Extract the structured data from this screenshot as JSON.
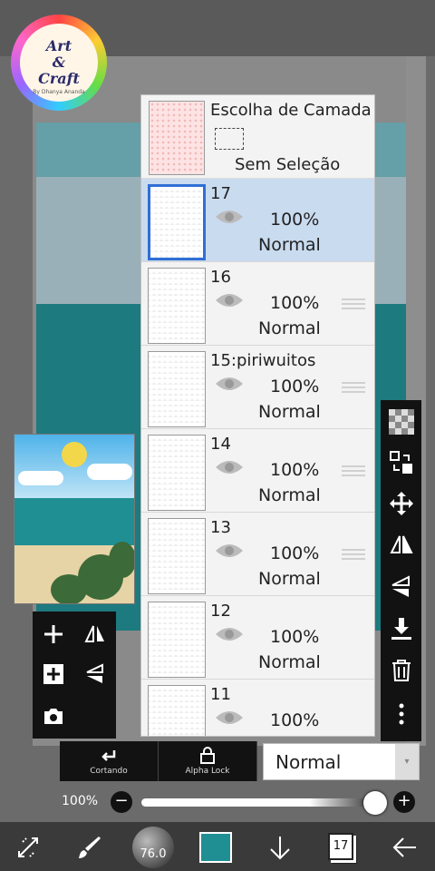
{
  "logo": {
    "line1": "Art",
    "line2": "&",
    "line3": "Craft",
    "subtitle": "By Dhanya Ananda"
  },
  "selection_layer": {
    "title": "Escolha de Camada",
    "status": "Sem Seleção"
  },
  "layers": [
    {
      "name": "17",
      "opacity": "100%",
      "blend": "Normal",
      "selected": true
    },
    {
      "name": "16",
      "opacity": "100%",
      "blend": "Normal",
      "selected": false
    },
    {
      "name": "15:piriwuitos",
      "opacity": "100%",
      "blend": "Normal",
      "selected": false
    },
    {
      "name": "14",
      "opacity": "100%",
      "blend": "Normal",
      "selected": false
    },
    {
      "name": "13",
      "opacity": "100%",
      "blend": "Normal",
      "selected": false
    },
    {
      "name": "12",
      "opacity": "100%",
      "blend": "Normal",
      "selected": false
    },
    {
      "name": "11",
      "opacity": "100%",
      "blend": "",
      "selected": false
    }
  ],
  "bottom_buttons": {
    "clipping": "Cortando",
    "alpha_lock": "Alpha Lock"
  },
  "blend_mode": {
    "value": "Normal"
  },
  "opacity": {
    "label": "100%",
    "value": 100,
    "minus": "−",
    "plus": "+"
  },
  "toolbar": {
    "brush_size": "76.0",
    "layer_count": "17",
    "color": "#1f8f94"
  },
  "colors": {
    "accent": "#2f6fd6",
    "selected_row": "#c9dbef",
    "teal": "#1f8f94"
  }
}
